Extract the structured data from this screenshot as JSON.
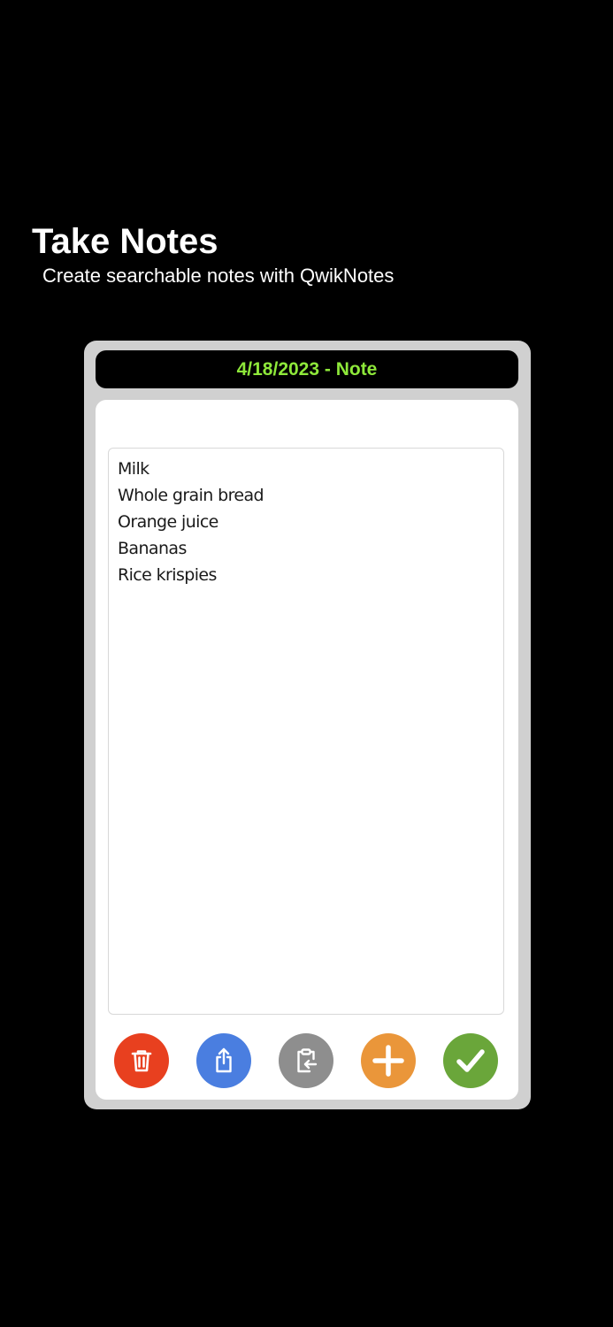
{
  "header": {
    "title": "Take Notes",
    "subtitle": "Create searchable notes with QwikNotes"
  },
  "note": {
    "title": "4/18/2023 - Note",
    "lines": [
      "Milk",
      "Whole grain bread",
      "Orange juice",
      "Bananas",
      "Rice krispies"
    ]
  },
  "toolbar": {
    "buttons": [
      {
        "name": "delete",
        "icon": "trash-icon",
        "color": "#e8401f"
      },
      {
        "name": "share",
        "icon": "share-icon",
        "color": "#4a7ee0"
      },
      {
        "name": "paste",
        "icon": "clipboard-paste-icon",
        "color": "#8e8e8e"
      },
      {
        "name": "add",
        "icon": "plus-icon",
        "color": "#ea963a"
      },
      {
        "name": "done",
        "icon": "checkmark-icon",
        "color": "#6aa63a"
      }
    ]
  },
  "colors": {
    "background": "#000000",
    "frame": "#d0d0d0",
    "title_accent": "#8ee83a"
  }
}
